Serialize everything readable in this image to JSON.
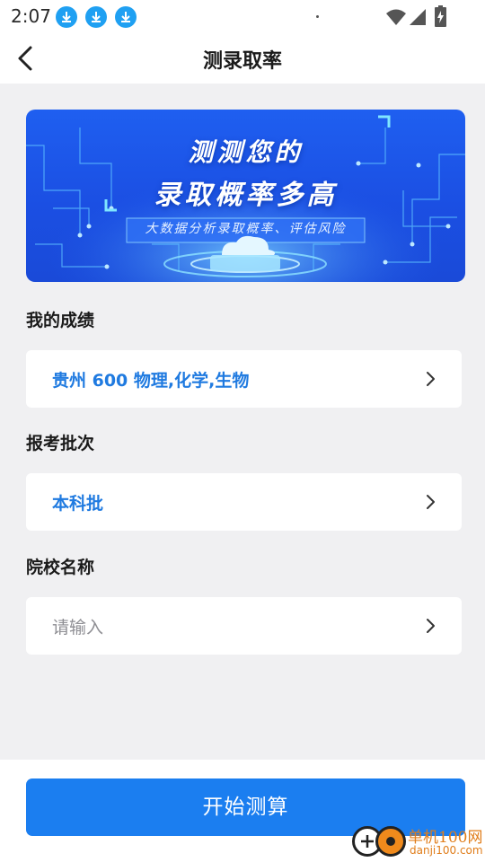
{
  "status_bar": {
    "time": "2:07",
    "icons": [
      "download-icon",
      "download-icon",
      "download-icon",
      "wifi-icon",
      "signal-icon",
      "battery-charging-icon"
    ],
    "accent_color": "#1fa0f2"
  },
  "nav": {
    "title": "测录取率",
    "back_icon": "chevron-left-icon"
  },
  "banner": {
    "line1": "测测您的",
    "line2": "录取概率多高",
    "subtitle": "大数据分析录取概率、评估风险",
    "colors": {
      "primary": "#1f5ff0",
      "glow": "#7fd8ff"
    }
  },
  "form": {
    "score": {
      "label": "我的成绩",
      "value": "贵州 600 物理,化学,生物"
    },
    "batch": {
      "label": "报考批次",
      "value": "本科批"
    },
    "school": {
      "label": "院校名称",
      "placeholder": "请输入"
    },
    "value_color": "#1f7ae0",
    "chevron_icon": "chevron-right-icon"
  },
  "actions": {
    "start_label": "开始测算",
    "button_color": "#1b7ef0"
  },
  "watermark": {
    "cn_text": "单机100网",
    "url_text": "danji100.com",
    "color": "#e07d1a"
  }
}
